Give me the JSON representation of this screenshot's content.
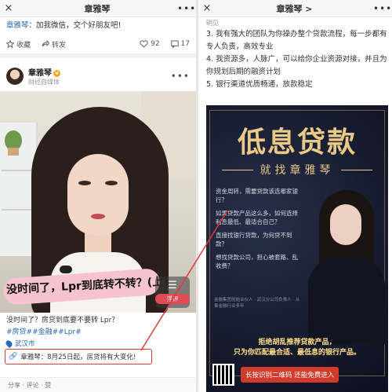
{
  "left": {
    "topbar": {
      "close": "×",
      "title": "章雅琴",
      "more": "•••"
    },
    "repost": {
      "author": "章雅琴",
      "text": "：加我微信，交个好朋友吧!"
    },
    "actions": {
      "collect": "收藏",
      "forward": "转发",
      "likes": "92",
      "comments": "17"
    },
    "poster": {
      "name": "章雅琴",
      "subtitle": "财经自媒体",
      "more": "•••"
    },
    "video": {
      "caption": "没时间了，Lpr到底转不转？(上)",
      "float_label": "浮评"
    },
    "body": "没时间了？房贷到底要不要转 Lpr？",
    "tags": "#房贷##金融##Lpr#",
    "location": "武汉市",
    "highlight": "章雅琴：8月25日起，房贷将有大变化!",
    "bottom": "分享  ·  评论  ·  赞"
  },
  "right": {
    "topbar": {
      "close": "×",
      "title": "章雅琴 >",
      "more": "•••"
    },
    "article": {
      "cut": "明见",
      "p3": "3. 我有强大的团队为你操办整个贷款流程，每一步都有专人负责，高效专业",
      "p4": "4. 我资源多，人脉广，可以给你企业资源对接，并且为你规划后期的融资计划",
      "p5": "5. 银行渠道优质畅通，放款稳定"
    },
    "ad": {
      "headline": "低息贷款",
      "subhead": "就找章雅琴",
      "qa": [
        "资金周转，需要贷款该选哪家银行？",
        "如果贷款产品这么多，如何选择利息最低、最适合自己？",
        "直接找银行贷款，为何贷不到款？",
        "想找贷款公司，担心被套路、乱收费？"
      ],
      "credit": "金融集团创始合伙人 · 武汉分公司负责人 · 从事金融行业多年",
      "slogan1": "拒绝胡乱推荐贷款产品，",
      "slogan2": "只为你匹配最合适、最低息的银行产品。",
      "cta": "长按识别二维码 还能免费进入"
    }
  },
  "colors": {
    "accent_link": "#2a6ab2",
    "highlight_border": "#e03b3b",
    "ad_gold": "#e9c987",
    "ad_bg": "#151a2d"
  }
}
